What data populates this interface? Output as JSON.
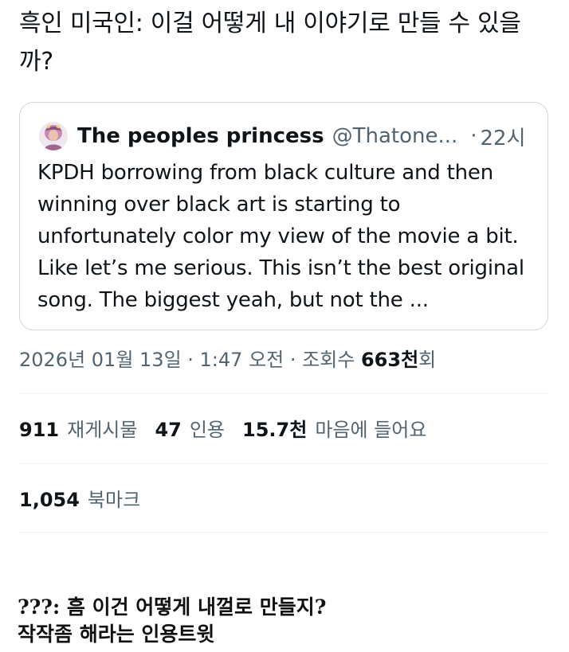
{
  "tweet": {
    "text": "흑인 미국인: 이걸 어떻게 내 이야기로 만들 수 있을까?"
  },
  "quote": {
    "name": "The peoples princess",
    "handle": "@Thatone...",
    "separator": "·",
    "time": "22시",
    "body": "KPDH borrowing from black culture and then winning over black art is starting to unfortunately color my view of the movie a bit. Like let’s me serious. This isn’t the best original song. The biggest yeah, but not the ..."
  },
  "meta": {
    "date_time": "2026년 01월 13일 · 1:47 오전 · 조회수 ",
    "views_value": "663천",
    "views_suffix": "회"
  },
  "stats": {
    "reposts_value": "911",
    "reposts_label": "재게시물",
    "quotes_value": "47",
    "quotes_label": "인용",
    "likes_value": "15.7천",
    "likes_label": "마음에 들어요"
  },
  "bookmarks": {
    "value": "1,054",
    "label": "북마크"
  },
  "caption": {
    "line1": "???: 흠 이건 어떻게 내껄로 만들지?",
    "line2": "작작좀 해라는 인용트윗"
  },
  "colors": {
    "text_primary": "#0f1419",
    "text_secondary": "#536471",
    "border": "#cfd9de",
    "divider": "#eff3f4"
  }
}
